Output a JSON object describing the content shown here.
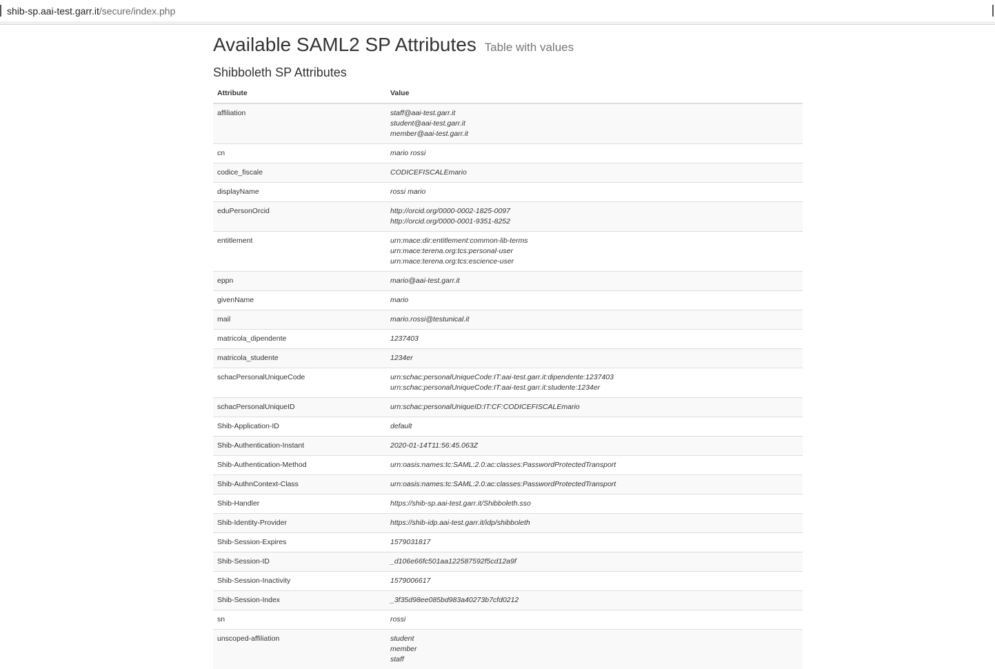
{
  "browser": {
    "url_host": "shib-sp.aai-test.garr.it",
    "url_path": "/secure/index.php"
  },
  "page": {
    "title": "Available SAML2 SP Attributes",
    "subtitle": "Table with values",
    "section_title": "Shibboleth SP Attributes"
  },
  "table": {
    "headers": {
      "attribute": "Attribute",
      "value": "Value"
    },
    "rows": [
      {
        "name": "affiliation",
        "values": [
          "staff@aai-test.garr.it",
          "student@aai-test.garr.it",
          "member@aai-test.garr.it"
        ]
      },
      {
        "name": "cn",
        "values": [
          "mario rossi"
        ]
      },
      {
        "name": "codice_fiscale",
        "values": [
          "CODICEFISCALEmario"
        ]
      },
      {
        "name": "displayName",
        "values": [
          "rossi mario"
        ]
      },
      {
        "name": "eduPersonOrcid",
        "values": [
          "http://orcid.org/0000-0002-1825-0097",
          "http://orcid.org/0000-0001-9351-8252"
        ]
      },
      {
        "name": "entitlement",
        "values": [
          "urn:mace:dir:entitlement:common-lib-terms",
          "urn:mace:terena.org:tcs:personal-user",
          "urn:mace:terena.org:tcs:escience-user"
        ]
      },
      {
        "name": "eppn",
        "values": [
          "mario@aai-test.garr.it"
        ]
      },
      {
        "name": "givenName",
        "values": [
          "mario"
        ]
      },
      {
        "name": "mail",
        "values": [
          "mario.rossi@testunical.it"
        ]
      },
      {
        "name": "matricola_dipendente",
        "values": [
          "1237403"
        ]
      },
      {
        "name": "matricola_studente",
        "values": [
          "1234er"
        ]
      },
      {
        "name": "schacPersonalUniqueCode",
        "values": [
          "urn:schac:personalUniqueCode:IT:aai-test.garr.it:dipendente:1237403",
          "urn:schac:personalUniqueCode:IT:aai-test.garr.it:studente:1234er"
        ]
      },
      {
        "name": "schacPersonalUniqueID",
        "values": [
          "urn:schac:personalUniqueID:IT:CF:CODICEFISCALEmario"
        ]
      },
      {
        "name": "Shib-Application-ID",
        "values": [
          "default"
        ]
      },
      {
        "name": "Shib-Authentication-Instant",
        "values": [
          "2020-01-14T11:56:45.063Z"
        ]
      },
      {
        "name": "Shib-Authentication-Method",
        "values": [
          "urn:oasis:names:tc:SAML:2.0:ac:classes:PasswordProtectedTransport"
        ]
      },
      {
        "name": "Shib-AuthnContext-Class",
        "values": [
          "urn:oasis:names:tc:SAML:2.0:ac:classes:PasswordProtectedTransport"
        ]
      },
      {
        "name": "Shib-Handler",
        "values": [
          "https://shib-sp.aai-test.garr.it/Shibboleth.sso"
        ]
      },
      {
        "name": "Shib-Identity-Provider",
        "values": [
          "https://shib-idp.aai-test.garr.it/idp/shibboleth"
        ]
      },
      {
        "name": "Shib-Session-Expires",
        "values": [
          "1579031817"
        ]
      },
      {
        "name": "Shib-Session-ID",
        "values": [
          "_d106e66fc501aa122587592f5cd12a9f"
        ]
      },
      {
        "name": "Shib-Session-Inactivity",
        "values": [
          "1579006617"
        ]
      },
      {
        "name": "Shib-Session-Index",
        "values": [
          "_3f35d98ee085bd983a40273b7cfd0212"
        ]
      },
      {
        "name": "sn",
        "values": [
          "rossi"
        ]
      },
      {
        "name": "unscoped-affiliation",
        "values": [
          "student",
          "member",
          "staff"
        ]
      }
    ]
  }
}
